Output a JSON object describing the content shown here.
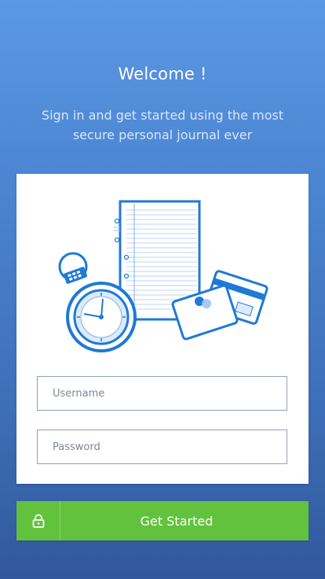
{
  "header": {
    "title": "Welcome !",
    "subtitle": "Sign in and get started using the most secure personal journal ever"
  },
  "illustration": {
    "icons": [
      "stopwatch-icon",
      "notebook-icon",
      "credit-card-icon"
    ],
    "accent_color": "#1f79d6",
    "fill_color": "#dcebfb"
  },
  "form": {
    "username_placeholder": "Username",
    "password_placeholder": "Password"
  },
  "cta": {
    "icon": "lock-icon",
    "label": "Get Started",
    "color": "#62c23d"
  },
  "colors": {
    "background_top": "#5b98e4",
    "background_bottom": "#31589b"
  }
}
